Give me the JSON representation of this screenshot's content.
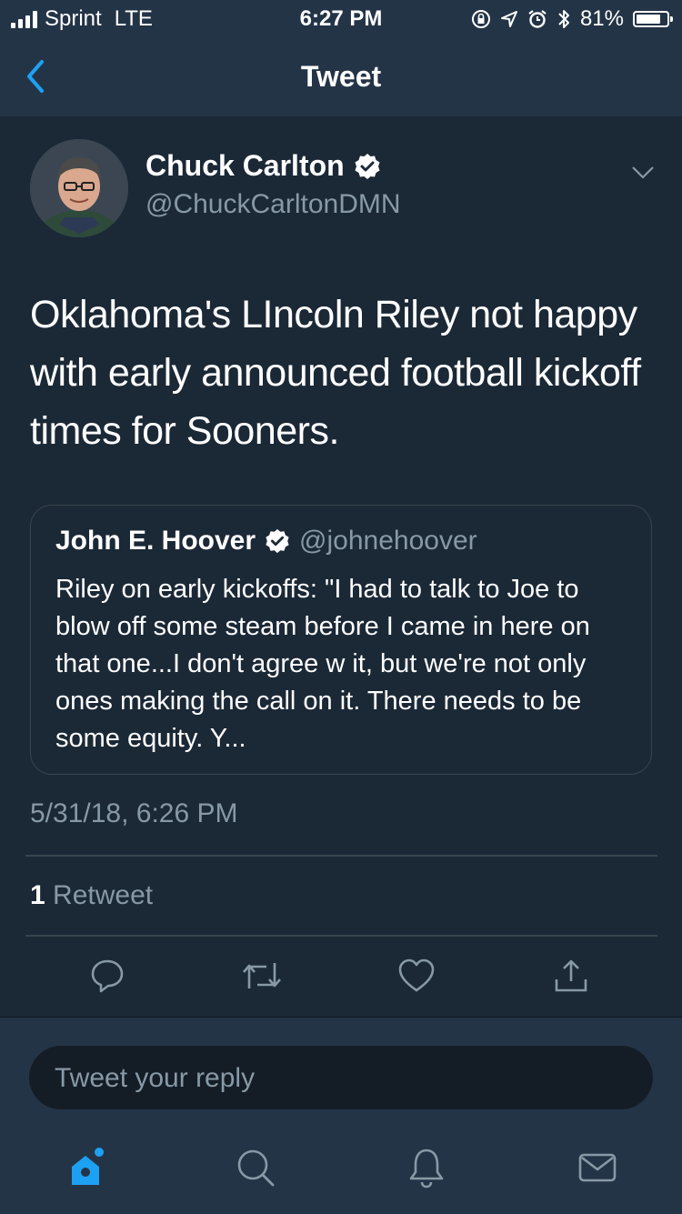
{
  "status_bar": {
    "carrier": "Sprint",
    "network": "LTE",
    "time": "6:27 PM",
    "battery": "81%",
    "battery_level": 0.81,
    "icons": [
      "lock-rotation-icon",
      "location-icon",
      "alarm-icon",
      "bluetooth-icon"
    ]
  },
  "nav": {
    "title": "Tweet",
    "back_icon": "back-chevron-icon"
  },
  "tweet": {
    "author_name": "Chuck Carlton",
    "author_handle": "@ChuckCarltonDMN",
    "verified": true,
    "text": "Oklahoma's LIncoln Riley not happy with early announced football kickoff times for Sooners.",
    "quoted": {
      "name": "John E. Hoover",
      "handle": "@johnehoover",
      "verified": true,
      "text": "Riley on early kickoffs: \"I had to talk to Joe to blow off some steam before I came in here on that one...I don't agree w it, but we're not only ones making the call on it. There needs to be some equity. Y..."
    },
    "timestamp": "5/31/18, 6:26 PM",
    "retweet_count": "1",
    "retweet_label": "Retweet",
    "actions": [
      "reply-icon",
      "retweet-icon",
      "like-icon",
      "share-icon"
    ]
  },
  "reply_box": {
    "placeholder": "Tweet your reply"
  },
  "tab_bar": {
    "tabs": [
      "home-icon",
      "search-icon",
      "notifications-icon",
      "messages-icon"
    ]
  },
  "colors": {
    "background": "#1b2836",
    "header": "#243447",
    "accent": "#1da1f2",
    "secondary_text": "#8899a6"
  }
}
